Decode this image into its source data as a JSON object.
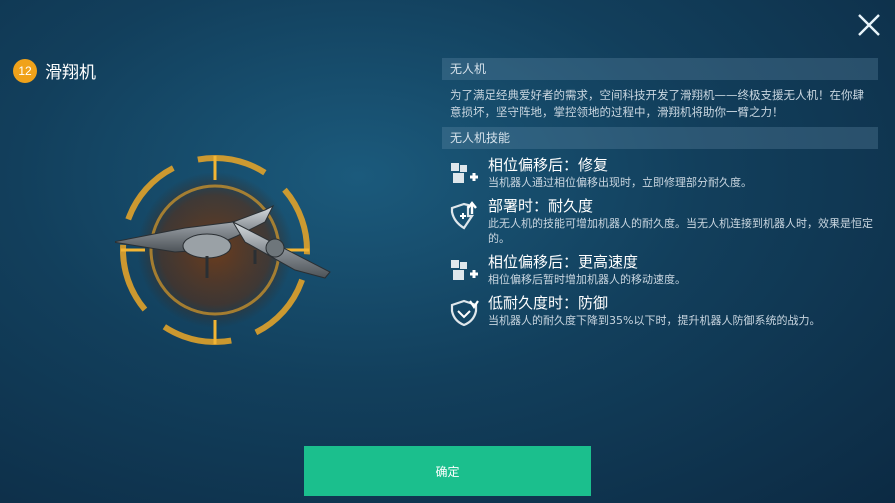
{
  "header": {
    "level": "12",
    "drone_name": "滑翔机"
  },
  "info": {
    "section_title": "无人机",
    "description": "为了满足经典爱好者的需求，空间科技开发了滑翔机——终极支援无人机！在你肆意损坏，坚守阵地，掌控领地的过程中，滑翔机将助你一臂之力！"
  },
  "skills_section": {
    "title": "无人机技能",
    "skills": [
      {
        "icon": "repair-icon",
        "title": "相位偏移后：修复",
        "desc": "当机器人通过相位偏移出现时，立即修理部分耐久度。"
      },
      {
        "icon": "shield-plus-icon",
        "title": "部署时：耐久度",
        "desc": "此无人机的技能可增加机器人的耐久度。当无人机连接到机器人时，效果是恒定的。"
      },
      {
        "icon": "speed-icon",
        "title": "相位偏移后：更高速度",
        "desc": "相位偏移后暂时增加机器人的移动速度。"
      },
      {
        "icon": "defense-icon",
        "title": "低耐久度时：防御",
        "desc": "当机器人的耐久度下降到35%以下时，提升机器人防御系统的战力。"
      }
    ]
  },
  "footer": {
    "confirm_label": "确定"
  },
  "colors": {
    "accent_orange": "#f0a21a",
    "confirm_green": "#1bbf8d"
  }
}
